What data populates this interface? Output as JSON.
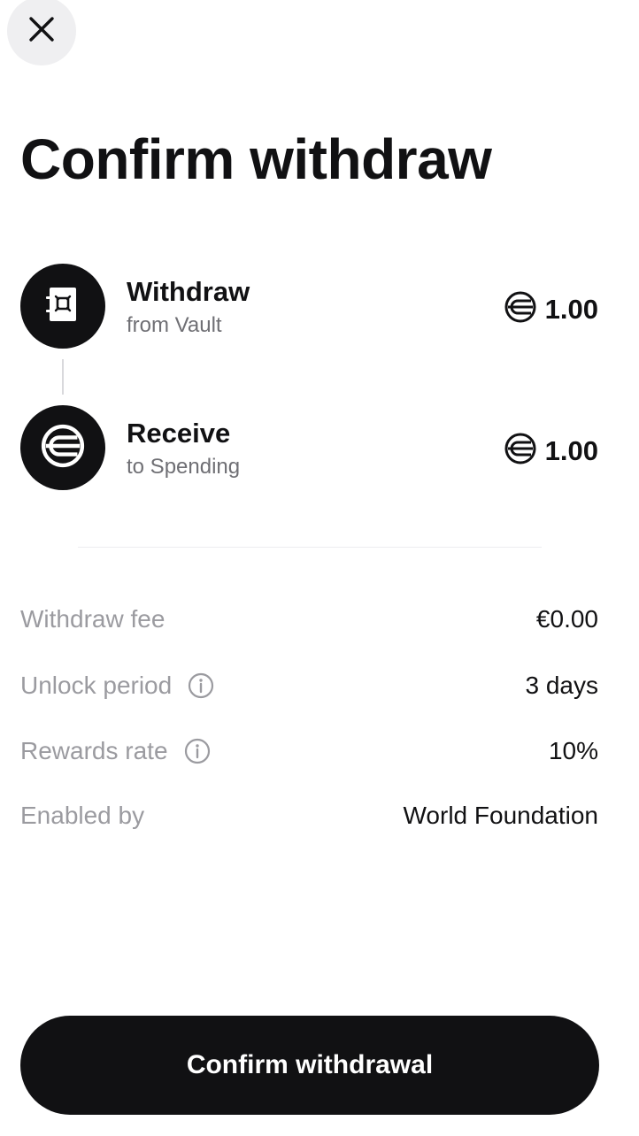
{
  "header": {
    "close_icon": "close-icon",
    "title": "Confirm withdraw"
  },
  "steps": [
    {
      "icon": "vault-icon",
      "title": "Withdraw",
      "subtitle": "from Vault",
      "token_icon": "worldcoin-icon",
      "amount": "1.00"
    },
    {
      "icon": "worldcoin-icon",
      "title": "Receive",
      "subtitle": "to Spending",
      "token_icon": "worldcoin-icon",
      "amount": "1.00"
    }
  ],
  "details": [
    {
      "label": "Withdraw fee",
      "value": "€0.00",
      "info": false
    },
    {
      "label": "Unlock period",
      "value": "3 days",
      "info": true
    },
    {
      "label": "Rewards rate",
      "value": "10%",
      "info": true
    },
    {
      "label": "Enabled by",
      "value": "World Foundation",
      "info": false
    }
  ],
  "actions": {
    "confirm_label": "Confirm withdrawal"
  },
  "colors": {
    "primary": "#111113",
    "muted_text": "#9b9ba0",
    "secondary_text": "#6f6f74",
    "close_bg": "#efeff1"
  }
}
